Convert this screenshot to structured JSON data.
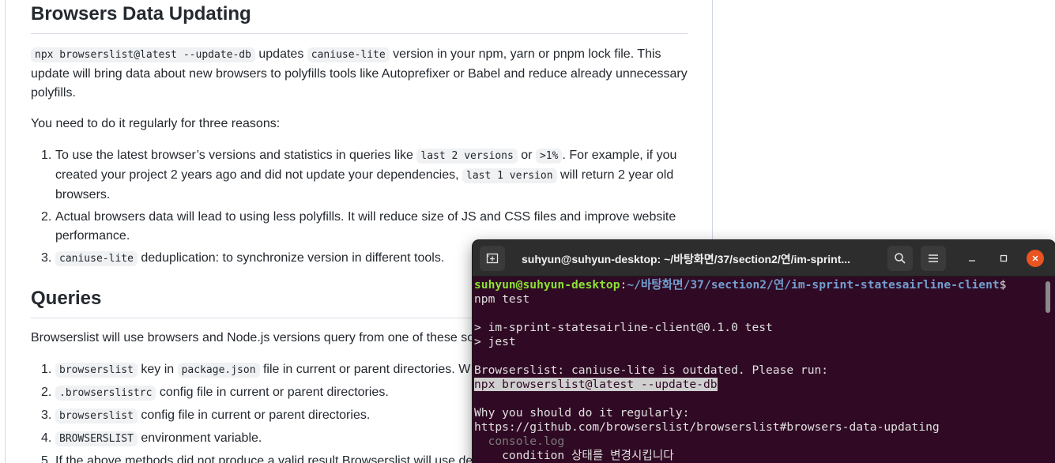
{
  "doc": {
    "heading1": "Browsers Data Updating",
    "para1": {
      "code1": "npx browserslist@latest --update-db",
      "t1": " updates ",
      "code2": "caniuse-lite",
      "t2": " version in your npm, yarn or pnpm lock file. This update will bring data about new browsers to polyfills tools like Autoprefixer or Babel and reduce already unnecessary polyfills."
    },
    "para2": "You need to do it regularly for three reasons:",
    "reasons": {
      "r1": {
        "num": "1.",
        "t1": "To use the latest browser’s versions and statistics in queries like ",
        "code1": "last 2 versions",
        "t2": " or ",
        "code2": ">1%",
        "t3": ". For example, if you created your project 2 years ago and did not update your dependencies, ",
        "code3": "last 1 version",
        "t4": " will return 2 year old browsers."
      },
      "r2": {
        "num": "2.",
        "text": "Actual browsers data will lead to using less polyfills. It will reduce size of JS and CSS files and improve website performance."
      },
      "r3": {
        "num": "3.",
        "code1": "caniuse-lite",
        "t1": " deduplication: to synchronize version in different tools."
      }
    },
    "heading2": "Queries",
    "para3": "Browserslist will use browsers and Node.js versions query from one of these so",
    "sources": {
      "s1": {
        "num": "1.",
        "code1": "browserslist",
        "t1": " key in ",
        "code2": "package.json",
        "t2": " file in current or parent directories. W"
      },
      "s2": {
        "num": "2.",
        "code1": ".browserslistrc",
        "t1": " config file in current or parent directories."
      },
      "s3": {
        "num": "3.",
        "code1": "browserslist",
        "t1": " config file in current or parent directories."
      },
      "s4": {
        "num": "4.",
        "code1": "BROWSERSLIST",
        "t1": " environment variable."
      },
      "s5": {
        "num": "5.",
        "t1": "If the above methods did not produce a valid result Browserslist will use de"
      }
    }
  },
  "terminal": {
    "title": "suhyun@suhyun-desktop: ~/바탕화면/37/section2/연/im-sprint...",
    "prompt_user": "suhyun@suhyun-desktop",
    "prompt_sep": ":",
    "prompt_path_a": "~/바탕화면",
    "prompt_path_b": "/37/section2/",
    "prompt_path_c": "연",
    "prompt_path_d": "/im-sprint-statesairline-client",
    "prompt_dollar": "$",
    "command": "npm test",
    "out1": "> im-sprint-statesairline-client@0.1.0 test",
    "out2": "> jest",
    "out3": "Browserslist: caniuse-lite is outdated. Please run:",
    "out4": "npx browserslist@latest --update-db",
    "out5": "Why you should do it regularly:",
    "out6": "https://github.com/browserslist/browserslist#browsers-data-updating",
    "out7": "  console.log",
    "out8": "    condition 상태를 변경시킵니다",
    "colors": {
      "background": "#300a24",
      "prompt_user": "#8ae234",
      "prompt_path": "#729fcf",
      "close_button": "#e95420"
    },
    "icons": [
      "new-tab-icon",
      "search-icon",
      "hamburger-menu-icon",
      "minimize-icon",
      "maximize-icon",
      "close-icon"
    ]
  }
}
